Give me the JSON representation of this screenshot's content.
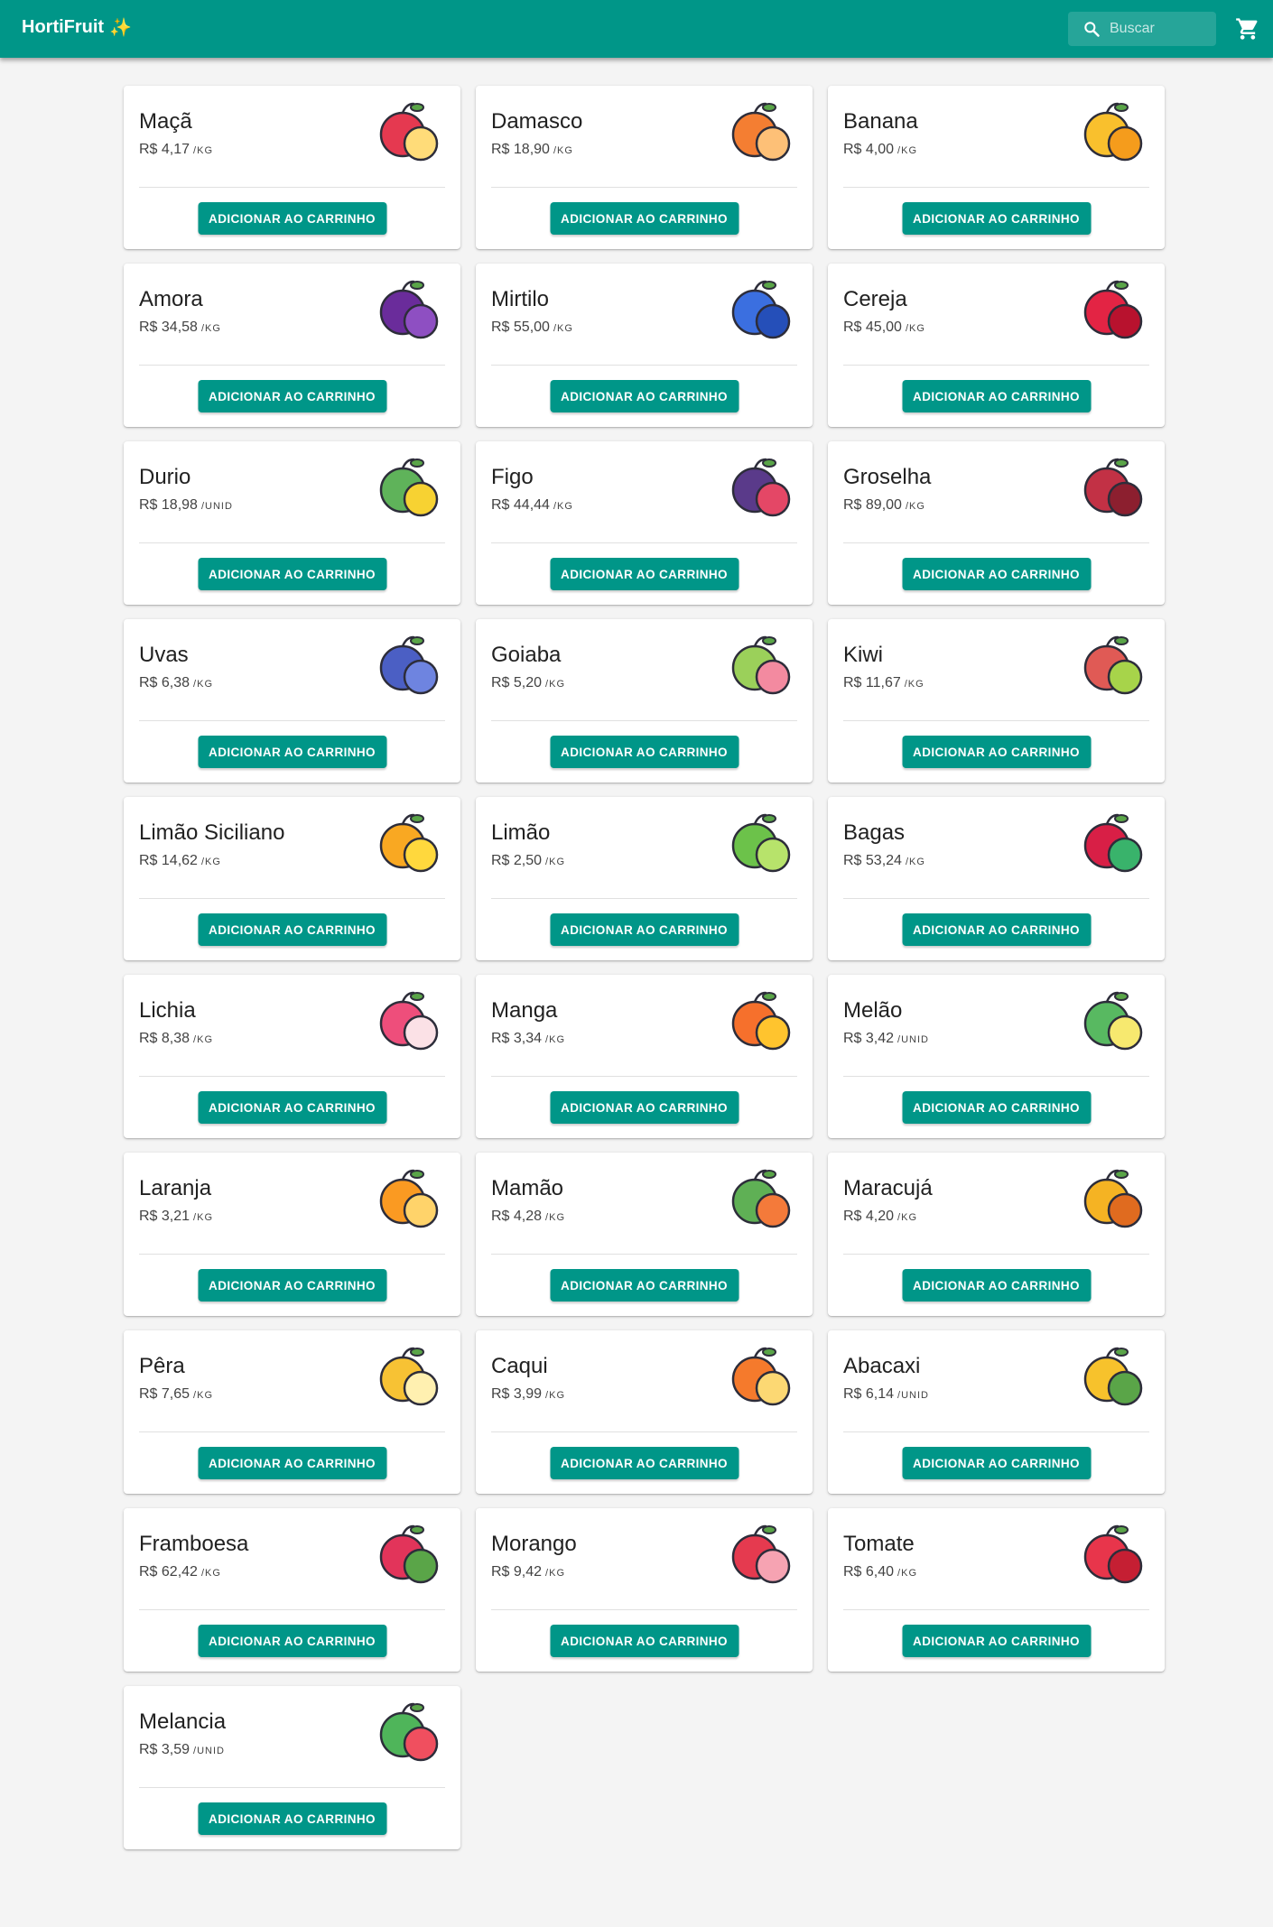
{
  "app": {
    "title": "HortiFruit",
    "title_emoji": "✨"
  },
  "search": {
    "placeholder": "Buscar",
    "icon": "search-icon"
  },
  "cart": {
    "icon": "cart-icon"
  },
  "colors": {
    "primary": "#009688",
    "background": "#f4f4f4",
    "card": "#ffffff"
  },
  "button_label": "ADICIONAR AO CARRINHO",
  "products": [
    {
      "name": "Maçã",
      "price": "R$ 4,17",
      "unit": "/KG",
      "icon": "apple-icon",
      "colors": [
        "#e53950",
        "#ffdc79"
      ]
    },
    {
      "name": "Damasco",
      "price": "R$ 18,90",
      "unit": "/KG",
      "icon": "apricot-icon",
      "colors": [
        "#f47e32",
        "#fdc077"
      ]
    },
    {
      "name": "Banana",
      "price": "R$ 4,00",
      "unit": "/KG",
      "icon": "banana-icon",
      "colors": [
        "#f9c02d",
        "#f59c1c"
      ]
    },
    {
      "name": "Amora",
      "price": "R$ 34,58",
      "unit": "/KG",
      "icon": "blackberry-icon",
      "colors": [
        "#6a2c9b",
        "#8e4fc2"
      ]
    },
    {
      "name": "Mirtilo",
      "price": "R$ 55,00",
      "unit": "/KG",
      "icon": "blueberry-icon",
      "colors": [
        "#3b6fe0",
        "#254fb9"
      ]
    },
    {
      "name": "Cereja",
      "price": "R$ 45,00",
      "unit": "/KG",
      "icon": "cherry-icon",
      "colors": [
        "#e32444",
        "#b8122e"
      ]
    },
    {
      "name": "Durio",
      "price": "R$ 18,98",
      "unit": "/UNID",
      "icon": "durian-icon",
      "colors": [
        "#5fb35a",
        "#f7d232"
      ]
    },
    {
      "name": "Figo",
      "price": "R$ 44,44",
      "unit": "/KG",
      "icon": "fig-icon",
      "colors": [
        "#5a3a8a",
        "#e44766"
      ]
    },
    {
      "name": "Groselha",
      "price": "R$ 89,00",
      "unit": "/KG",
      "icon": "gooseberry-icon",
      "colors": [
        "#c23145",
        "#8c1f2f"
      ]
    },
    {
      "name": "Uvas",
      "price": "R$ 6,38",
      "unit": "/KG",
      "icon": "grapes-icon",
      "colors": [
        "#4b5fc4",
        "#6e84e0"
      ]
    },
    {
      "name": "Goiaba",
      "price": "R$ 5,20",
      "unit": "/KG",
      "icon": "guava-icon",
      "colors": [
        "#9bd05a",
        "#f38aa0"
      ]
    },
    {
      "name": "Kiwi",
      "price": "R$ 11,67",
      "unit": "/KG",
      "icon": "kiwi-icon",
      "colors": [
        "#e05a55",
        "#a7d44a"
      ]
    },
    {
      "name": "Limão Siciliano",
      "price": "R$ 14,62",
      "unit": "/KG",
      "icon": "lemon-icon",
      "colors": [
        "#f9a822",
        "#ffd83d"
      ]
    },
    {
      "name": "Limão",
      "price": "R$ 2,50",
      "unit": "/KG",
      "icon": "lime-icon",
      "colors": [
        "#6cc24a",
        "#b7e36b"
      ]
    },
    {
      "name": "Bagas",
      "price": "R$ 53,24",
      "unit": "/KG",
      "icon": "berries-icon",
      "colors": [
        "#d81f46",
        "#39b36b"
      ]
    },
    {
      "name": "Lichia",
      "price": "R$ 8,38",
      "unit": "/KG",
      "icon": "lychee-icon",
      "colors": [
        "#ee4e7b",
        "#fbe1e6"
      ]
    },
    {
      "name": "Manga",
      "price": "R$ 3,34",
      "unit": "/KG",
      "icon": "mango-icon",
      "colors": [
        "#f6702c",
        "#ffc42e"
      ]
    },
    {
      "name": "Melão",
      "price": "R$ 3,42",
      "unit": "/UNID",
      "icon": "melon-icon",
      "colors": [
        "#58b961",
        "#f7e96f"
      ]
    },
    {
      "name": "Laranja",
      "price": "R$ 3,21",
      "unit": "/KG",
      "icon": "orange-icon",
      "colors": [
        "#fa9a22",
        "#ffd36a"
      ]
    },
    {
      "name": "Mamão",
      "price": "R$ 4,28",
      "unit": "/KG",
      "icon": "papaya-icon",
      "colors": [
        "#5fb055",
        "#f47a3a"
      ]
    },
    {
      "name": "Maracujá",
      "price": "R$ 4,20",
      "unit": "/KG",
      "icon": "passionfruit-icon",
      "colors": [
        "#f5b323",
        "#e06b1f"
      ]
    },
    {
      "name": "Pêra",
      "price": "R$ 7,65",
      "unit": "/KG",
      "icon": "pear-icon",
      "colors": [
        "#f7c234",
        "#fff0b0"
      ]
    },
    {
      "name": "Caqui",
      "price": "R$ 3,99",
      "unit": "/KG",
      "icon": "persimmon-icon",
      "colors": [
        "#f57a2c",
        "#fcd873"
      ]
    },
    {
      "name": "Abacaxi",
      "price": "R$ 6,14",
      "unit": "/UNID",
      "icon": "pineapple-icon",
      "colors": [
        "#f7c22c",
        "#5aa548"
      ]
    },
    {
      "name": "Framboesa",
      "price": "R$ 62,42",
      "unit": "/KG",
      "icon": "raspberry-icon",
      "colors": [
        "#e2345a",
        "#5aa548"
      ]
    },
    {
      "name": "Morango",
      "price": "R$ 9,42",
      "unit": "/KG",
      "icon": "strawberry-icon",
      "colors": [
        "#e53a4f",
        "#f6a3b2"
      ]
    },
    {
      "name": "Tomate",
      "price": "R$ 6,40",
      "unit": "/KG",
      "icon": "tomato-icon",
      "colors": [
        "#e8354b",
        "#c51f33"
      ]
    },
    {
      "name": "Melancia",
      "price": "R$ 3,59",
      "unit": "/UNID",
      "icon": "watermelon-icon",
      "colors": [
        "#4fb55a",
        "#f04f5f"
      ]
    }
  ]
}
